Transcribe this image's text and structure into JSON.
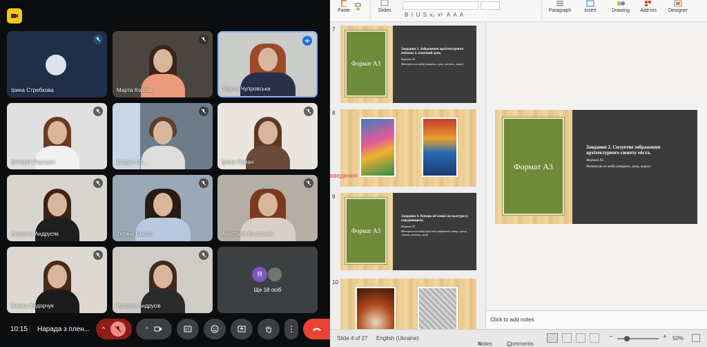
{
  "meeting": {
    "time": "10:15",
    "title": "Нарада з плен...",
    "more_people": "Ще 18 осіб",
    "avatar_letter": "Я",
    "participants": [
      {
        "name": "Ірина Стребкова"
      },
      {
        "name": "Марта Король"
      },
      {
        "name": "Марта Чупровська"
      },
      {
        "name": "Вікторія Ящишин"
      },
      {
        "name": "Богдан Ос..."
      },
      {
        "name": "Ірина Ясман"
      },
      {
        "name": "Ангеліна Андрусяк"
      },
      {
        "name": "Тетяна Смаль"
      },
      {
        "name": "Анастасія Васильків"
      },
      {
        "name": "Іванна Федорчук"
      },
      {
        "name": "Наталія Андрусів"
      }
    ]
  },
  "ribbon": {
    "paste": "Paste",
    "slides": "Slides",
    "paragraph": "Paragraph",
    "insert": "Insert",
    "drawing": "Drawing",
    "addins": "Add-ins",
    "designer": "Designer"
  },
  "slides": [
    {
      "number": "7",
      "box": "Формат А3",
      "heading": "Завдання 3. Зображення архітектурного пейзажу в сонячний день.",
      "b1": "Формат А3.",
      "b2": "Матеріали на вибір (акварель, гуаш, пастель, акрил)"
    },
    {
      "number": "8"
    },
    {
      "number": "9",
      "box": "Формат А3",
      "heading": "Завдання 4. Начерк об'ємної скульптури (з середовищем).",
      "b1": "Формат А3.",
      "b2": "Матеріали на вибір (простий графітний олівець, вугіль, сангіна, пастель, туш)"
    },
    {
      "number": "10"
    }
  ],
  "overlay_text": "введення",
  "main_slide": {
    "box": "Формат А3",
    "heading": "Завдання 2. Силуетне зображення архітектурного сюжету міста.",
    "b1": "Формат А3.",
    "b2": "Матеріали на вибір (акварель, гуаш, акрил)"
  },
  "notes_placeholder": "Click to add notes",
  "status": {
    "slide": "Slide 4 of 27",
    "language": "English (Ukraine)",
    "notes": "Notes",
    "comments": "Comments",
    "zoom": "50%"
  },
  "colors": {
    "end_call": "#ea4335",
    "green_box": "#6e8a3a",
    "dark_panel": "#3b3b3b"
  }
}
